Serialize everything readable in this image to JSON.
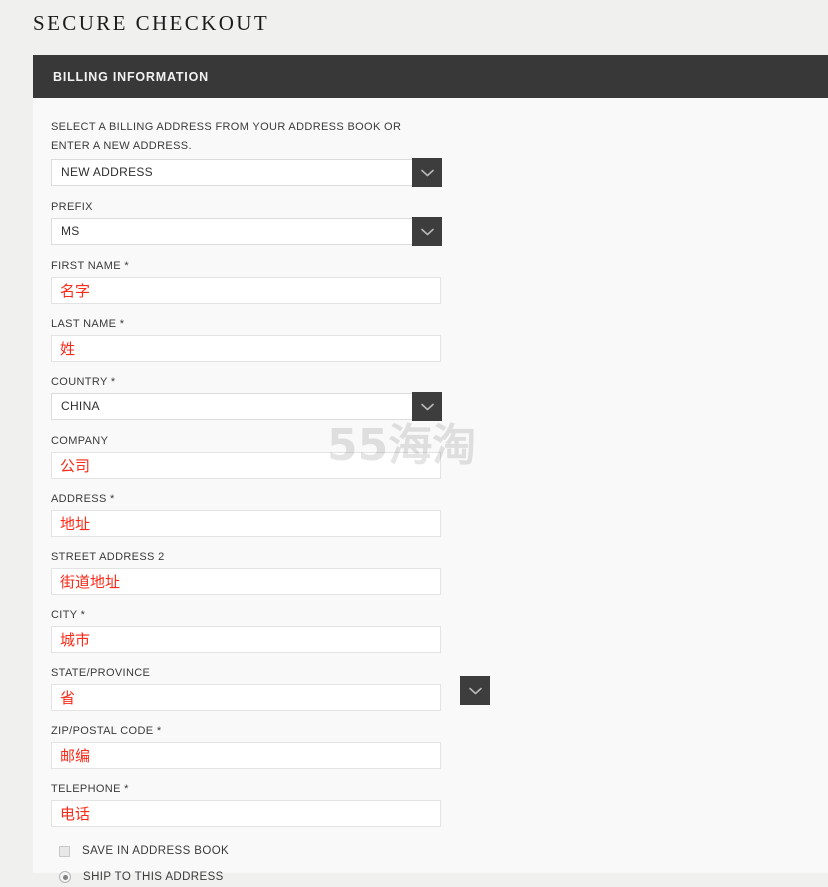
{
  "page": {
    "title": "SECURE CHECKOUT",
    "background_color": "#f0f1ee",
    "panel_color": "#f9f9f9"
  },
  "section": {
    "header": "BILLING INFORMATION",
    "header_bg": "#383838",
    "header_text_color": "#f2f2f2"
  },
  "form": {
    "intro_label": "SELECT A BILLING ADDRESS FROM YOUR ADDRESS BOOK OR ENTER A NEW ADDRESS.",
    "address_book_select": {
      "label": "",
      "value": "NEW ADDRESS",
      "icon": "chevron-down-icon"
    },
    "prefix": {
      "label": "PREFIX",
      "value": "MS",
      "icon": "chevron-down-icon"
    },
    "first_name": {
      "label": "FIRST NAME *",
      "value": "名字"
    },
    "last_name": {
      "label": "LAST NAME *",
      "value": "姓"
    },
    "country": {
      "label": "COUNTRY *",
      "value": "CHINA",
      "icon": "chevron-down-icon"
    },
    "company": {
      "label": "COMPANY",
      "value": "公司"
    },
    "address": {
      "label": "ADDRESS *",
      "value": "地址"
    },
    "street_address_2": {
      "label": "STREET ADDRESS 2",
      "value": "街道地址"
    },
    "city": {
      "label": "CITY *",
      "value": "城市"
    },
    "state_province": {
      "label": "STATE/PROVINCE",
      "value": "省",
      "icon": "chevron-down-icon"
    },
    "zip": {
      "label": "ZIP/POSTAL CODE *",
      "value": "邮编"
    },
    "telephone": {
      "label": "TELEPHONE *",
      "value": "电话"
    },
    "save_in_address_book": {
      "label": "SAVE IN ADDRESS BOOK",
      "checked": false
    },
    "ship_to_this_address": {
      "label": "SHIP TO THIS ADDRESS",
      "selected": true
    },
    "input_value_color": "#fc2a17"
  },
  "watermark": {
    "text": "55海淘"
  }
}
